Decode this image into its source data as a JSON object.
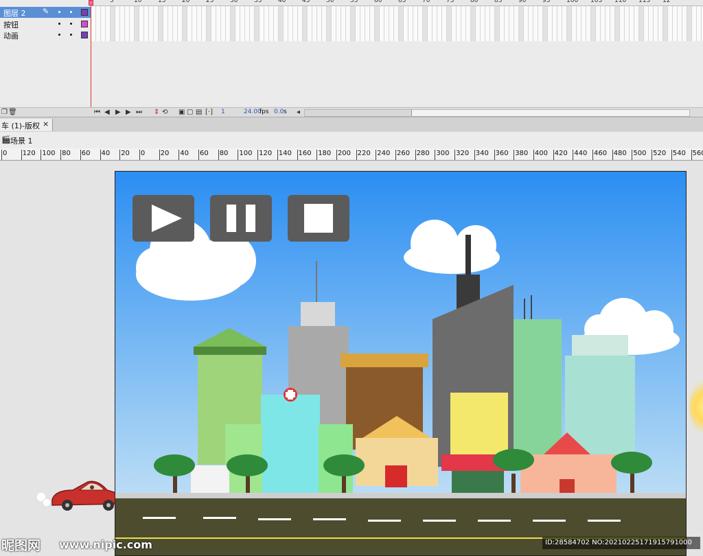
{
  "timeline": {
    "layers": [
      {
        "name": "图层 2",
        "selected": true,
        "color": "#7a3fb8"
      },
      {
        "name": "按钮",
        "selected": false,
        "color": "#d24fd2"
      },
      {
        "name": "动画",
        "selected": false,
        "color": "#7a3fb8"
      }
    ],
    "frame_numbers": [
      "5",
      "10",
      "15",
      "20",
      "25",
      "30",
      "35",
      "40",
      "45",
      "50",
      "55",
      "60",
      "65",
      "70",
      "75",
      "80",
      "85",
      "90",
      "95",
      "100",
      "105",
      "110",
      "115",
      "12"
    ],
    "current_frame": "1",
    "fps": "24.00",
    "fps_unit": "fps",
    "elapsed": "0.0",
    "elapsed_unit": "s"
  },
  "document": {
    "tab_title": "车 (1)-版权",
    "tab_close": "×",
    "scene_name": "场景 1"
  },
  "ruler": {
    "labels": [
      "0",
      "120",
      "100",
      "80",
      "60",
      "40",
      "20",
      "0",
      "20",
      "40",
      "60",
      "80",
      "100",
      "120",
      "140",
      "160",
      "180",
      "200",
      "220",
      "240",
      "260",
      "280",
      "300",
      "320",
      "340",
      "360",
      "380",
      "400",
      "420",
      "440",
      "460",
      "480",
      "500",
      "520",
      "540",
      "560"
    ]
  },
  "stage_buttons": [
    {
      "name": "play",
      "icon": "play-icon"
    },
    {
      "name": "pause",
      "icon": "pause-icon"
    },
    {
      "name": "stop",
      "icon": "stop-icon"
    }
  ],
  "watermark": {
    "logo": "昵图网",
    "site": "www.nipic.com",
    "id_text": "ID:28584702 NO:20210225171915791000"
  },
  "colors": {
    "sky_top": "#2b8ef2",
    "sky_bottom": "#bfe0f5",
    "road": "#4d4c2f",
    "car": "#c9302c",
    "button_bg": "#5b5b5b"
  }
}
